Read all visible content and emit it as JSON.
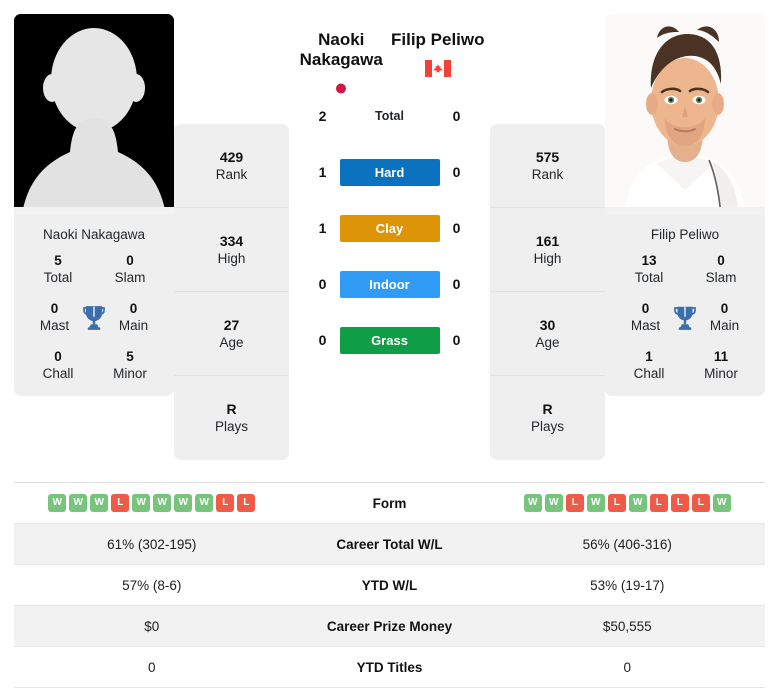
{
  "players": {
    "left": {
      "name": "Naoki Nakagawa",
      "display_name_line1": "Naoki",
      "display_name_line2": "Nakagawa",
      "country_flag": "japan-flag",
      "photo": "silhouette-placeholder",
      "titles": {
        "total": "5",
        "slam": "0",
        "mast": "0",
        "main": "0",
        "chall": "0",
        "minor": "5"
      },
      "stats": {
        "rank": "429",
        "high": "334",
        "age": "27",
        "plays": "R"
      },
      "form": [
        "W",
        "W",
        "W",
        "L",
        "W",
        "W",
        "W",
        "W",
        "L",
        "L"
      ],
      "career_total_wl": "61% (302-195)",
      "ytd_wl": "57% (8-6)",
      "career_prize_money": "$0",
      "ytd_titles": "0"
    },
    "right": {
      "name": "Filip Peliwo",
      "display_name_line1": "Filip Peliwo",
      "display_name_line2": "",
      "country_flag": "canada-flag",
      "photo": "player-portrait",
      "titles": {
        "total": "13",
        "slam": "0",
        "mast": "0",
        "main": "0",
        "chall": "1",
        "minor": "11"
      },
      "stats": {
        "rank": "575",
        "high": "161",
        "age": "30",
        "plays": "R"
      },
      "form": [
        "W",
        "W",
        "L",
        "W",
        "L",
        "W",
        "L",
        "L",
        "L",
        "W"
      ],
      "career_total_wl": "56% (406-316)",
      "ytd_wl": "53% (19-17)",
      "career_prize_money": "$50,555",
      "ytd_titles": "0"
    }
  },
  "titles_labels": {
    "total": "Total",
    "slam": "Slam",
    "mast": "Mast",
    "main": "Main",
    "chall": "Chall",
    "minor": "Minor",
    "trophy_icon": "trophy-icon"
  },
  "stats_labels": {
    "rank": "Rank",
    "high": "High",
    "age": "Age",
    "plays": "Plays"
  },
  "h2h": {
    "rows": [
      {
        "label": "Total",
        "left": "2",
        "right": "0",
        "type": "total",
        "color": ""
      },
      {
        "label": "Hard",
        "left": "1",
        "right": "0",
        "type": "surface",
        "color": "#0a72bf"
      },
      {
        "label": "Clay",
        "left": "1",
        "right": "0",
        "type": "surface",
        "color": "#dd9406"
      },
      {
        "label": "Indoor",
        "left": "0",
        "right": "0",
        "type": "surface",
        "color": "#2f9bf5"
      },
      {
        "label": "Grass",
        "left": "0",
        "right": "0",
        "type": "surface",
        "color": "#0f9d46"
      }
    ]
  },
  "table": {
    "rows": [
      {
        "key": "form",
        "label": "Form"
      },
      {
        "key": "career_total_wl",
        "label": "Career Total W/L"
      },
      {
        "key": "ytd_wl",
        "label": "YTD W/L"
      },
      {
        "key": "career_prize_money",
        "label": "Career Prize Money"
      },
      {
        "key": "ytd_titles",
        "label": "YTD Titles"
      }
    ]
  },
  "colors": {
    "win_badge": "#77c47c",
    "loss_badge": "#ef5b46",
    "panel_bg": "#efefef",
    "row_alt_bg": "#f2f2f2"
  }
}
